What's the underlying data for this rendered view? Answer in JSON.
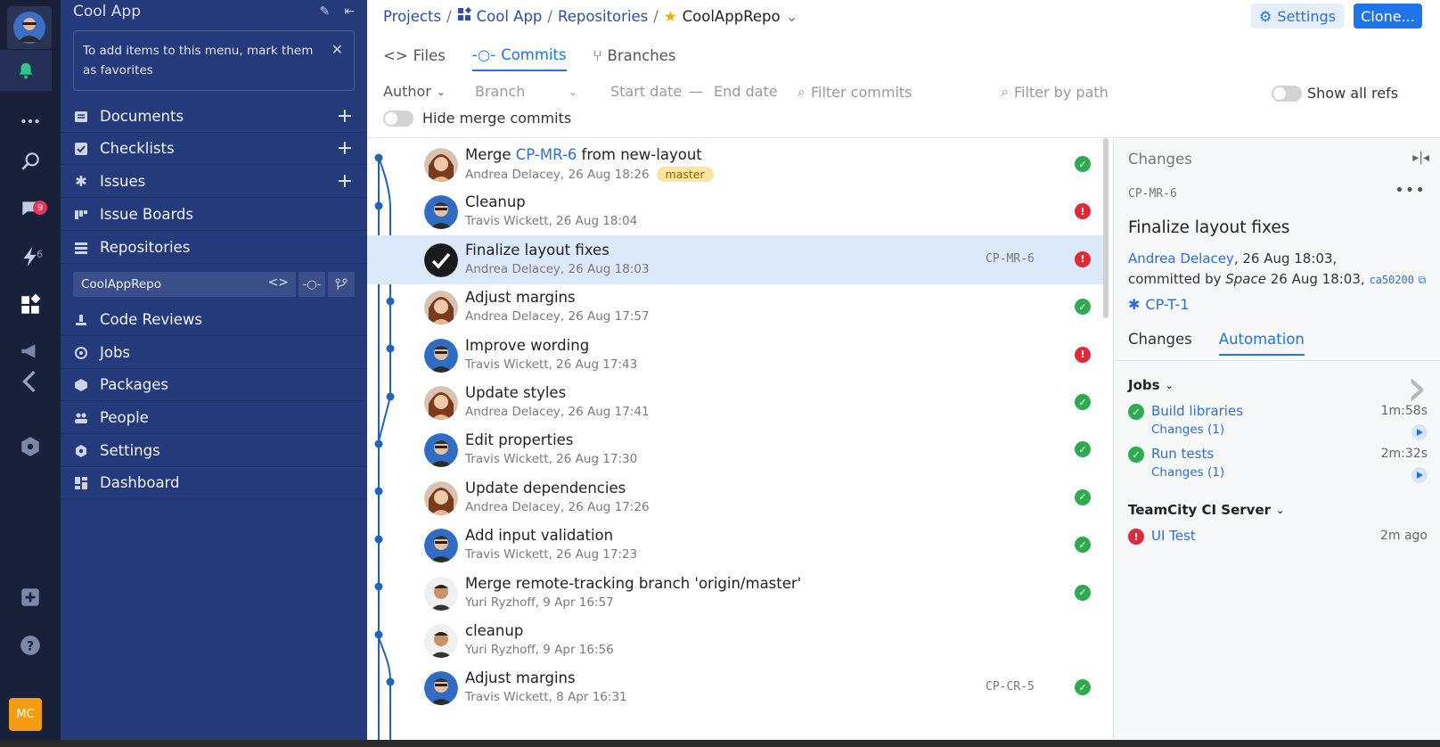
{
  "rail": {
    "badges": {
      "chats": "9",
      "updates": "6"
    },
    "user_initials": "MC"
  },
  "sidebar": {
    "project_name": "Cool App",
    "favorites_hint": "To add items to this menu, mark them as favorites",
    "items": [
      {
        "label": "Documents",
        "icon": "document-icon",
        "has_add": true
      },
      {
        "label": "Checklists",
        "icon": "checklist-icon",
        "has_add": true
      },
      {
        "label": "Issues",
        "icon": "asterisk-icon",
        "has_add": true
      },
      {
        "label": "Issue Boards",
        "icon": "board-icon",
        "has_add": false
      },
      {
        "label": "Repositories",
        "icon": "repository-icon",
        "has_add": false
      }
    ],
    "repo": {
      "name": "CoolAppRepo"
    },
    "items2": [
      {
        "label": "Code Reviews",
        "icon": "review-icon"
      },
      {
        "label": "Jobs",
        "icon": "jobs-icon"
      },
      {
        "label": "Packages",
        "icon": "package-icon"
      },
      {
        "label": "People",
        "icon": "people-icon"
      },
      {
        "label": "Settings",
        "icon": "gear-icon"
      },
      {
        "label": "Dashboard",
        "icon": "dashboard-icon"
      }
    ]
  },
  "breadcrumb": {
    "projects": "Projects",
    "project": "Cool App",
    "repositories": "Repositories",
    "repo": "CoolAppRepo"
  },
  "header": {
    "settings_label": "Settings",
    "clone_label": "Clone..."
  },
  "tabs": {
    "files": "Files",
    "commits": "Commits",
    "branches": "Branches"
  },
  "filters": {
    "author": "Author",
    "branch_placeholder": "Branch",
    "start_date": "Start date",
    "dash": "—",
    "end_date": "End date",
    "filter_commits": "Filter commits",
    "filter_path": "Filter by path",
    "show_all_refs": "Show all refs",
    "hide_merge": "Hide merge commits"
  },
  "commits": [
    {
      "title_prefix": "Merge ",
      "title_link": "CP-MR-6",
      "title_suffix": " from new-layout",
      "meta": "Andrea Delacey, 26 Aug 18:26",
      "tag": "master",
      "mr": "",
      "status": "ok",
      "avatar": "andrea"
    },
    {
      "title_prefix": "Cleanup",
      "title_link": "",
      "title_suffix": "",
      "meta": "Travis Wickett, 26 Aug 18:04",
      "tag": "",
      "mr": "",
      "status": "err",
      "avatar": "travis"
    },
    {
      "title_prefix": "Finalize layout fixes",
      "title_link": "",
      "title_suffix": "",
      "meta": "Andrea Delacey, 26 Aug 18:03",
      "tag": "",
      "mr": "CP-MR-6",
      "status": "err",
      "avatar": "check",
      "selected": true
    },
    {
      "title_prefix": "Adjust margins",
      "title_link": "",
      "title_suffix": "",
      "meta": "Andrea Delacey, 26 Aug 17:57",
      "tag": "",
      "mr": "",
      "status": "ok",
      "avatar": "andrea"
    },
    {
      "title_prefix": "Improve wording",
      "title_link": "",
      "title_suffix": "",
      "meta": "Travis Wickett, 26 Aug 17:43",
      "tag": "",
      "mr": "",
      "status": "err",
      "avatar": "travis"
    },
    {
      "title_prefix": "Update styles",
      "title_link": "",
      "title_suffix": "",
      "meta": "Andrea Delacey, 26 Aug 17:41",
      "tag": "",
      "mr": "",
      "status": "ok",
      "avatar": "andrea"
    },
    {
      "title_prefix": "Edit properties",
      "title_link": "",
      "title_suffix": "",
      "meta": "Travis Wickett, 26 Aug 17:30",
      "tag": "",
      "mr": "",
      "status": "ok",
      "avatar": "travis"
    },
    {
      "title_prefix": "Update dependencies",
      "title_link": "",
      "title_suffix": "",
      "meta": "Andrea Delacey, 26 Aug 17:26",
      "tag": "",
      "mr": "",
      "status": "ok",
      "avatar": "andrea"
    },
    {
      "title_prefix": "Add input validation",
      "title_link": "",
      "title_suffix": "",
      "meta": "Travis Wickett, 26 Aug 17:23",
      "tag": "",
      "mr": "",
      "status": "ok",
      "avatar": "travis"
    },
    {
      "title_prefix": "Merge remote-tracking branch 'origin/master'",
      "title_link": "",
      "title_suffix": "",
      "meta": "Yuri Ryzhoff, 9 Apr 16:57",
      "tag": "",
      "mr": "",
      "status": "ok",
      "avatar": "yuri"
    },
    {
      "title_prefix": "cleanup",
      "title_link": "",
      "title_suffix": "",
      "meta": "Yuri Ryzhoff, 9 Apr 16:56",
      "tag": "",
      "mr": "",
      "status": "",
      "avatar": "yuri"
    },
    {
      "title_prefix": "Adjust margins",
      "title_link": "",
      "title_suffix": "",
      "meta": "Travis Wickett, 8 Apr 16:31",
      "tag": "",
      "mr": "CP-CR-5",
      "status": "ok",
      "avatar": "travis"
    }
  ],
  "panel": {
    "header": "Changes",
    "id": "CP-MR-6",
    "title": "Finalize layout fixes",
    "author": "Andrea Delacey",
    "authored": ", 26 Aug 18:03,",
    "committed_by": "committed by ",
    "committer": "Space",
    "committed_at": " 26 Aug 18:03, ",
    "hash": "ca50200",
    "issue": "CP-T-1",
    "tab_changes": "Changes",
    "tab_automation": "Automation",
    "jobs_label": "Jobs",
    "jobs": [
      {
        "name": "Build libraries",
        "sub": "Changes (1)",
        "time": "1m:58s",
        "status": "ok"
      },
      {
        "name": "Run tests",
        "sub": "Changes (1)",
        "time": "2m:32s",
        "status": "ok"
      }
    ],
    "ci_label": "TeamCity CI Server",
    "ci_jobs": [
      {
        "name": "UI Test",
        "time": "2m ago",
        "status": "err"
      }
    ]
  },
  "colors": {
    "accent": "#1e74e8",
    "sidebar": "#243a7a",
    "rail": "#19213a",
    "success": "#2eaa51",
    "error": "#dd2b3a"
  }
}
